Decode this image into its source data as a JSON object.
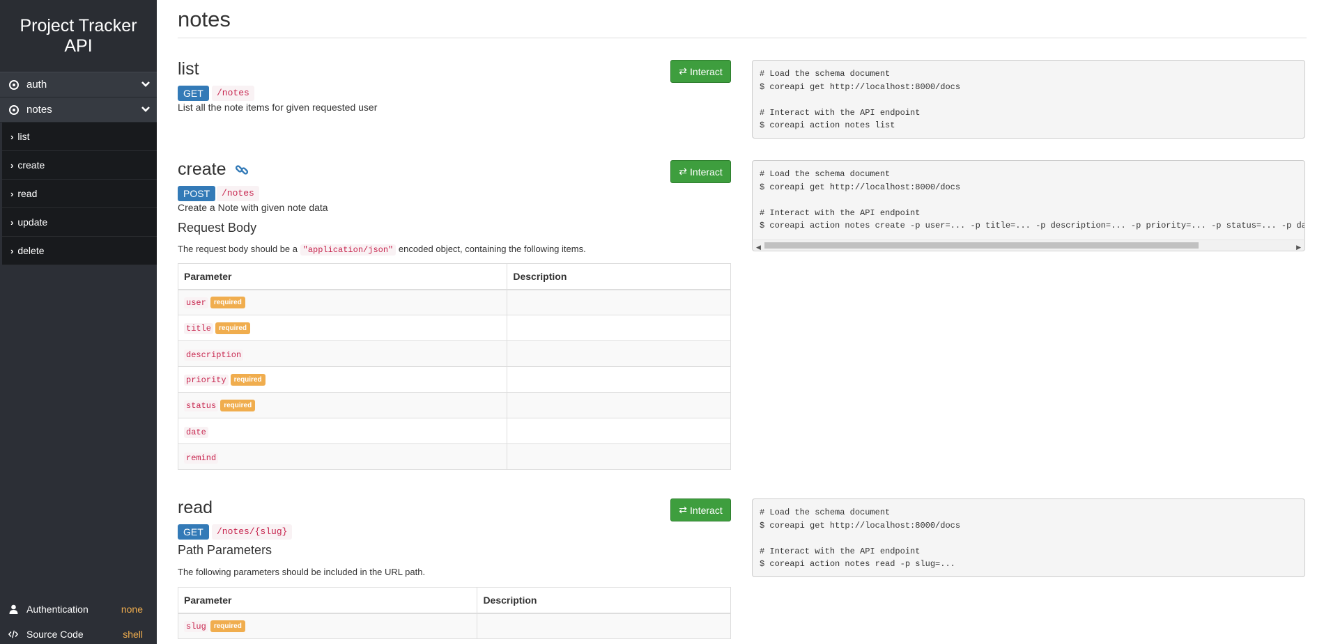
{
  "sidebar": {
    "title": "Project Tracker API",
    "groups": [
      {
        "label": "auth"
      },
      {
        "label": "notes"
      }
    ],
    "items": [
      {
        "label": "list"
      },
      {
        "label": "create"
      },
      {
        "label": "read"
      },
      {
        "label": "update"
      },
      {
        "label": "delete"
      }
    ],
    "footer": {
      "auth_label": "Authentication",
      "auth_value": "none",
      "source_label": "Source Code",
      "source_value": "shell"
    }
  },
  "page": {
    "title": "notes"
  },
  "interact_label": "Interact",
  "sections": {
    "list": {
      "title": "list",
      "method": "GET",
      "path": "/notes",
      "description": "List all the note items for given requested user",
      "code": [
        "# Load the schema document",
        "$ coreapi get http://localhost:8000/docs",
        "",
        "# Interact with the API endpoint",
        "$ coreapi action notes list"
      ]
    },
    "create": {
      "title": "create",
      "method": "POST",
      "path": "/notes",
      "description": "Create a Note with given note data",
      "subheading": "Request Body",
      "note_pre": "The request body should be a ",
      "note_code": "\"application/json\"",
      "note_post": " encoded object, containing the following items.",
      "col_param": "Parameter",
      "col_desc": "Description",
      "params": [
        {
          "name": "user",
          "badge": "required"
        },
        {
          "name": "title",
          "badge": "required"
        },
        {
          "name": "description",
          "badge": ""
        },
        {
          "name": "priority",
          "badge": "required"
        },
        {
          "name": "status",
          "badge": "required"
        },
        {
          "name": "date",
          "badge": ""
        },
        {
          "name": "remind",
          "badge": ""
        }
      ],
      "code": [
        "# Load the schema document",
        "$ coreapi get http://localhost:8000/docs",
        "",
        "# Interact with the API endpoint",
        "$ coreapi action notes create -p user=... -p title=... -p description=... -p priority=... -p status=... -p dat"
      ]
    },
    "read": {
      "title": "read",
      "method": "GET",
      "path": "/notes/{slug}",
      "subheading": "Path Parameters",
      "note": "The following parameters should be included in the URL path.",
      "col_param": "Parameter",
      "col_desc": "Description",
      "params": [
        {
          "name": "slug",
          "badge": "required"
        }
      ],
      "code": [
        "# Load the schema document",
        "$ coreapi get http://localhost:8000/docs",
        "",
        "# Interact with the API endpoint",
        "$ coreapi action notes read -p slug=..."
      ]
    }
  }
}
